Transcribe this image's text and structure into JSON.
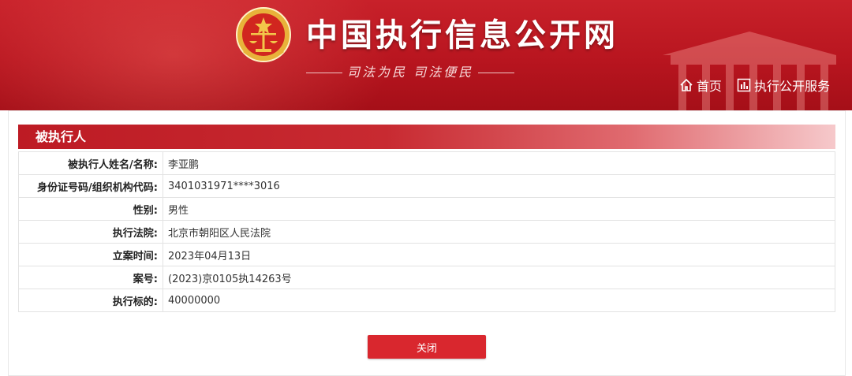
{
  "header": {
    "site_title": "中国执行信息公开网",
    "slogan": "司法为民  司法便民",
    "nav": {
      "home": "首页",
      "services": "执行公开服务"
    }
  },
  "section": {
    "title": "被执行人"
  },
  "fields": [
    {
      "label": "被执行人姓名/名称:",
      "value": "李亚鹏"
    },
    {
      "label": "身份证号码/组织机构代码:",
      "value": "3401031971****3016"
    },
    {
      "label": "性别:",
      "value": "男性"
    },
    {
      "label": "执行法院:",
      "value": "北京市朝阳区人民法院"
    },
    {
      "label": "立案时间:",
      "value": "2023年04月13日"
    },
    {
      "label": "案号:",
      "value": "(2023)京0105执14263号"
    },
    {
      "label": "执行标的:",
      "value": "40000000"
    }
  ],
  "actions": {
    "close_label": "关闭"
  },
  "colors": {
    "brand_red": "#c8212a",
    "button_red": "#d9272e"
  },
  "icons": {
    "emblem": "court-emblem-icon",
    "home": "home-icon",
    "services": "service-chart-icon"
  }
}
